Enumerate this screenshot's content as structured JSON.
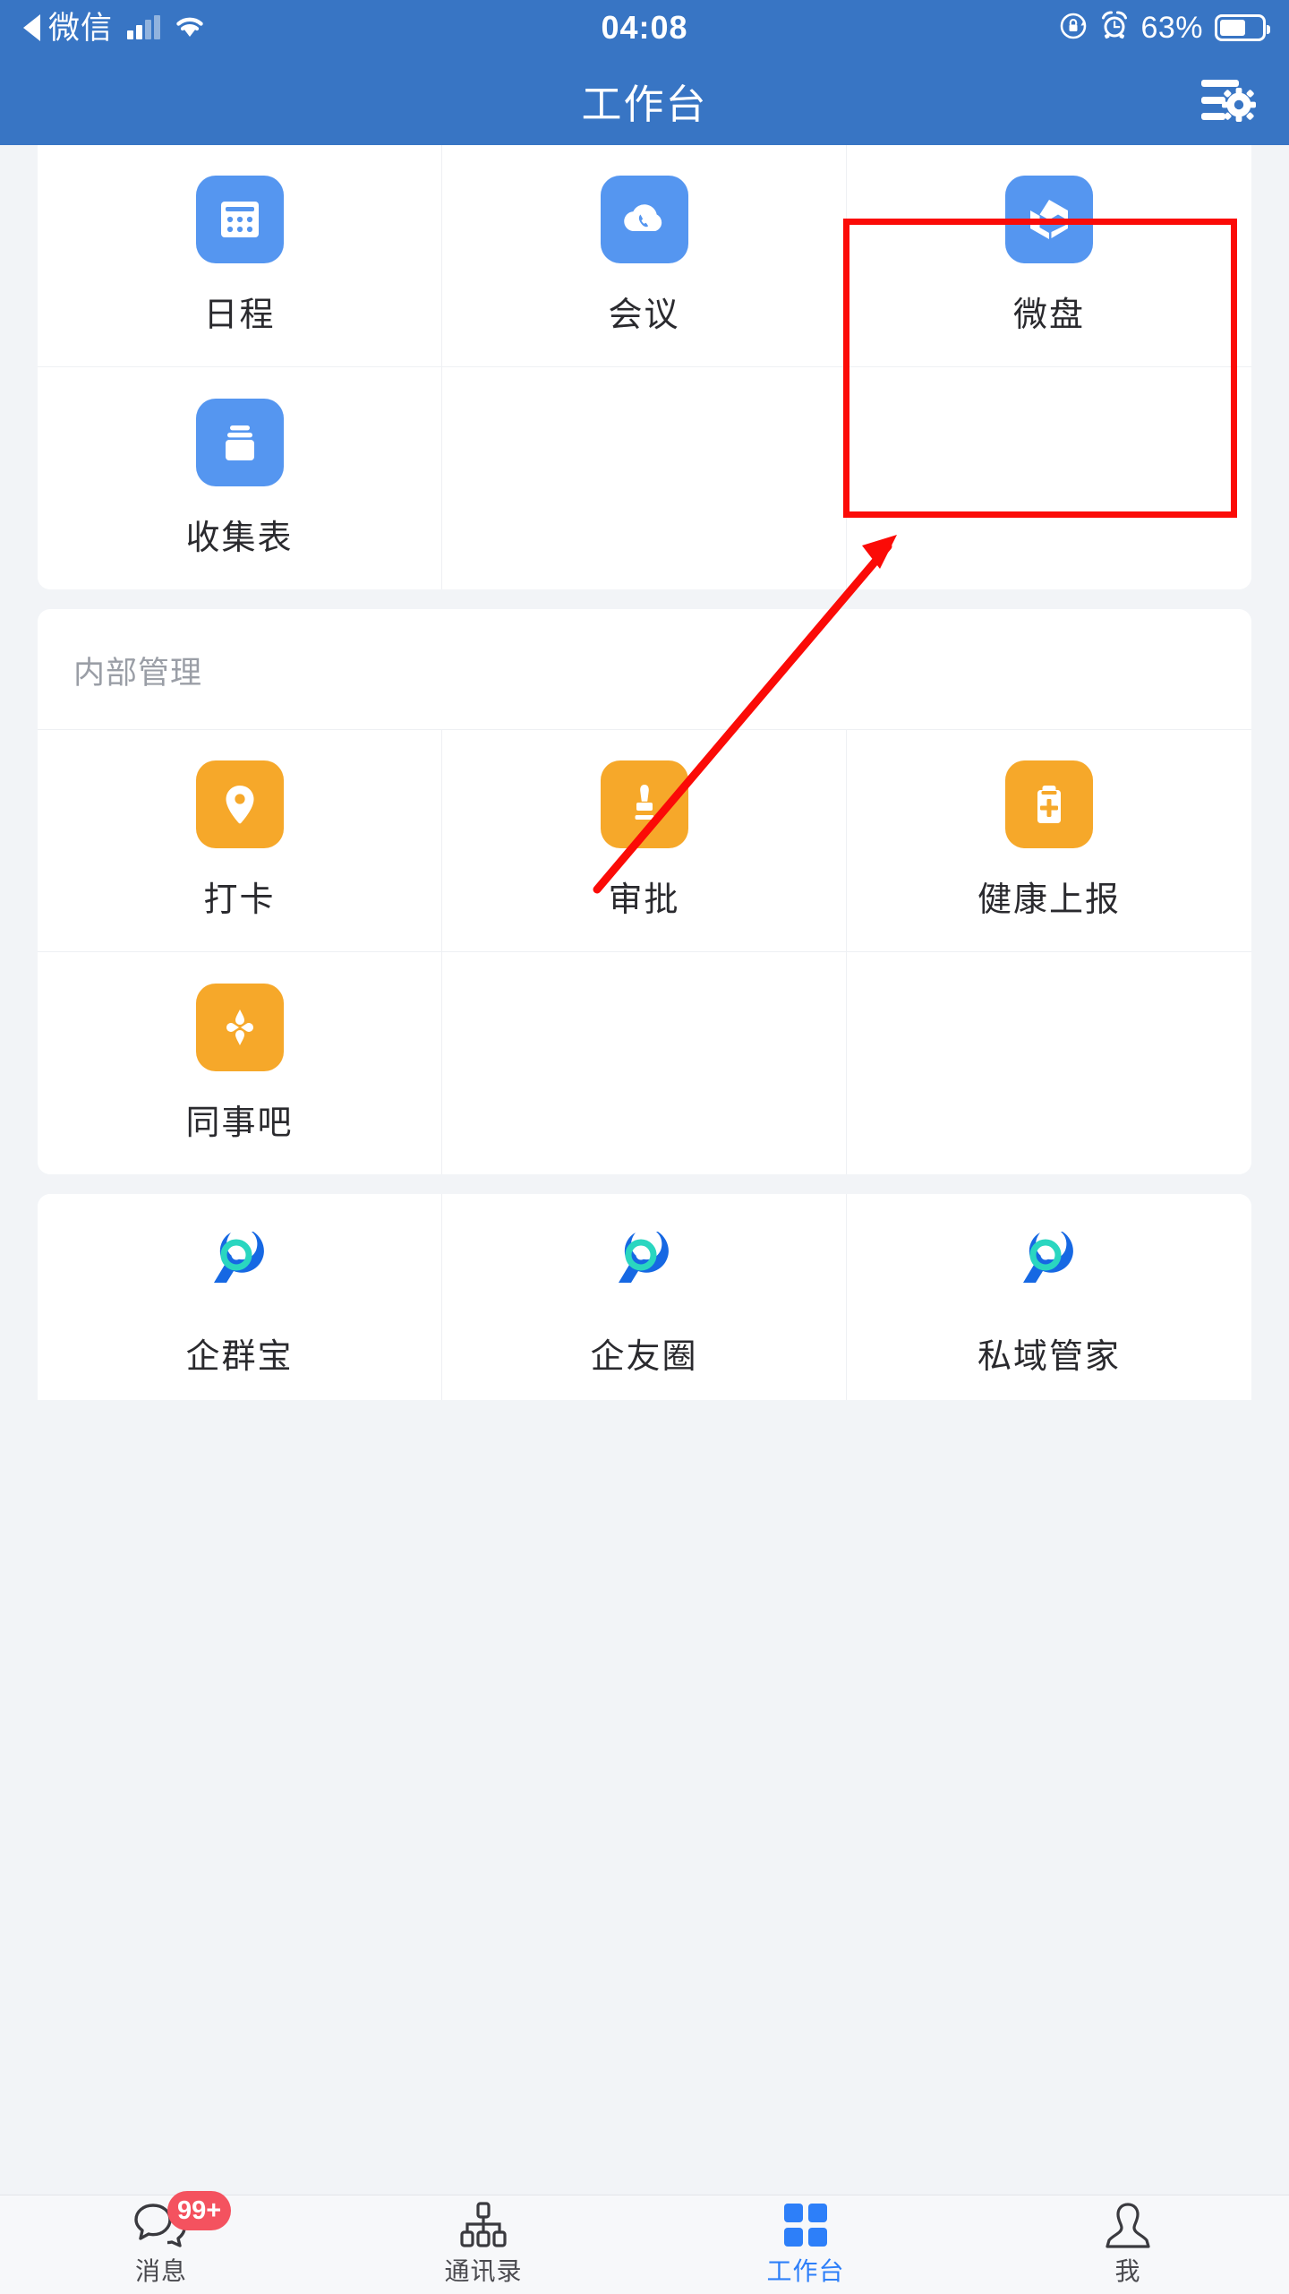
{
  "status_bar": {
    "back_app": "微信",
    "back_arrow_icon": "back-triangle-icon",
    "signal_icon": "cellular-signal-icon",
    "wifi_icon": "wifi-icon",
    "time": "04:08",
    "rotation_lock_icon": "rotation-lock-icon",
    "alarm_icon": "alarm-clock-icon",
    "battery_percent": "63%",
    "battery_icon": "battery-icon"
  },
  "navbar": {
    "title": "工作台",
    "settings_icon": "list-settings-gear-icon"
  },
  "sections": [
    {
      "id": "top-apps",
      "title": "",
      "items": [
        {
          "label": "日程",
          "icon": "calendar-icon",
          "color": "blue"
        },
        {
          "label": "会议",
          "icon": "cloud-phone-icon",
          "color": "blue"
        },
        {
          "label": "微盘",
          "icon": "cube-drive-icon",
          "color": "blue"
        },
        {
          "label": "收集表",
          "icon": "collection-box-icon",
          "color": "blue"
        }
      ]
    },
    {
      "id": "internal-management",
      "title": "内部管理",
      "items": [
        {
          "label": "打卡",
          "icon": "location-pin-icon",
          "color": "orange"
        },
        {
          "label": "审批",
          "icon": "stamp-icon",
          "color": "orange"
        },
        {
          "label": "健康上报",
          "icon": "clipboard-plus-icon",
          "color": "orange"
        },
        {
          "label": "同事吧",
          "icon": "colleague-nodes-icon",
          "color": "orange"
        }
      ]
    },
    {
      "id": "third-party-apps",
      "title": "",
      "items": [
        {
          "label": "企群宝",
          "icon": "swirl-logo-icon",
          "color": "plain"
        },
        {
          "label": "企友圈",
          "icon": "swirl-logo-icon",
          "color": "plain"
        },
        {
          "label": "私域管家",
          "icon": "swirl-logo-icon",
          "color": "plain"
        }
      ]
    }
  ],
  "annotations": {
    "highlight_target": "微盘",
    "highlight_color": "#fb0b07",
    "arrow_color": "#fb0b07",
    "arrow_points_to": "微盘"
  },
  "tabbar": {
    "items": [
      {
        "label": "消息",
        "icon": "chat-bubbles-icon",
        "badge": "99+",
        "active": false
      },
      {
        "label": "通讯录",
        "icon": "org-chart-icon",
        "badge": "",
        "active": false
      },
      {
        "label": "工作台",
        "icon": "grid-squares-icon",
        "badge": "",
        "active": true
      },
      {
        "label": "我",
        "icon": "person-icon",
        "badge": "",
        "active": false
      }
    ],
    "active_color": "#2d7ff9"
  }
}
